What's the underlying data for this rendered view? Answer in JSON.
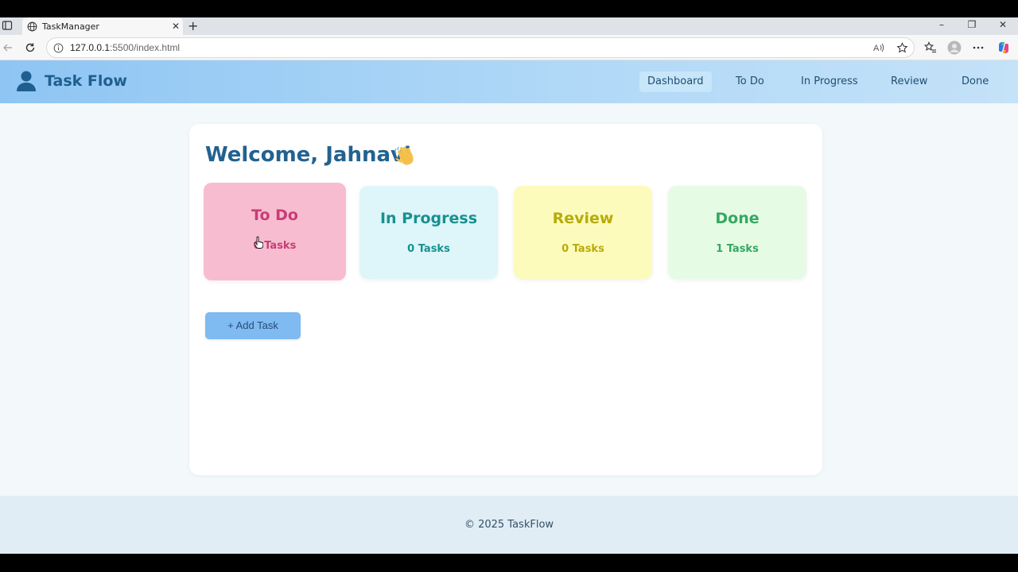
{
  "browser": {
    "tab_title": "TaskManager",
    "url_host": "127.0.0.1",
    "url_rest": ":5500/index.html"
  },
  "app": {
    "brand": "Task Flow",
    "nav": [
      {
        "label": "Dashboard",
        "active": true
      },
      {
        "label": "To Do"
      },
      {
        "label": "In Progress"
      },
      {
        "label": "Review"
      },
      {
        "label": "Done"
      }
    ]
  },
  "dashboard": {
    "welcome": "Welcome, Jahnavi",
    "cards": [
      {
        "title": "To Do",
        "count": "0 Tasks",
        "bg": "#f8bcd0",
        "color": "#c73d75"
      },
      {
        "title": "In Progress",
        "count": "0 Tasks",
        "bg": "#def5f9",
        "color": "#17918f"
      },
      {
        "title": "Review",
        "count": "0 Tasks",
        "bg": "#fdfbbc",
        "color": "#b7ab0c"
      },
      {
        "title": "Done",
        "count": "1 Tasks",
        "bg": "#e6fbe4",
        "color": "#35a863"
      }
    ],
    "add_button": "+ Add Task"
  },
  "footer": {
    "text": "© 2025 TaskFlow"
  },
  "colors": {
    "accent": "#7fbaf0",
    "brand": "#1f5f8f"
  }
}
